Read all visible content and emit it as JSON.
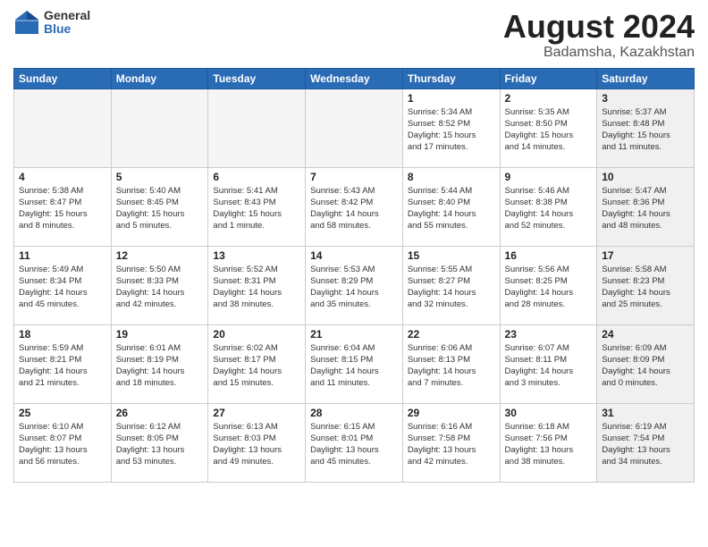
{
  "header": {
    "logo_general": "General",
    "logo_blue": "Blue",
    "title": "August 2024",
    "location": "Badamsha, Kazakhstan"
  },
  "weekdays": [
    "Sunday",
    "Monday",
    "Tuesday",
    "Wednesday",
    "Thursday",
    "Friday",
    "Saturday"
  ],
  "weeks": [
    [
      {
        "day": "",
        "detail": "",
        "empty": true
      },
      {
        "day": "",
        "detail": "",
        "empty": true
      },
      {
        "day": "",
        "detail": "",
        "empty": true
      },
      {
        "day": "",
        "detail": "",
        "empty": true
      },
      {
        "day": "1",
        "detail": "Sunrise: 5:34 AM\nSunset: 8:52 PM\nDaylight: 15 hours\nand 17 minutes."
      },
      {
        "day": "2",
        "detail": "Sunrise: 5:35 AM\nSunset: 8:50 PM\nDaylight: 15 hours\nand 14 minutes."
      },
      {
        "day": "3",
        "detail": "Sunrise: 5:37 AM\nSunset: 8:48 PM\nDaylight: 15 hours\nand 11 minutes.",
        "shaded": true
      }
    ],
    [
      {
        "day": "4",
        "detail": "Sunrise: 5:38 AM\nSunset: 8:47 PM\nDaylight: 15 hours\nand 8 minutes."
      },
      {
        "day": "5",
        "detail": "Sunrise: 5:40 AM\nSunset: 8:45 PM\nDaylight: 15 hours\nand 5 minutes."
      },
      {
        "day": "6",
        "detail": "Sunrise: 5:41 AM\nSunset: 8:43 PM\nDaylight: 15 hours\nand 1 minute."
      },
      {
        "day": "7",
        "detail": "Sunrise: 5:43 AM\nSunset: 8:42 PM\nDaylight: 14 hours\nand 58 minutes."
      },
      {
        "day": "8",
        "detail": "Sunrise: 5:44 AM\nSunset: 8:40 PM\nDaylight: 14 hours\nand 55 minutes."
      },
      {
        "day": "9",
        "detail": "Sunrise: 5:46 AM\nSunset: 8:38 PM\nDaylight: 14 hours\nand 52 minutes."
      },
      {
        "day": "10",
        "detail": "Sunrise: 5:47 AM\nSunset: 8:36 PM\nDaylight: 14 hours\nand 48 minutes.",
        "shaded": true
      }
    ],
    [
      {
        "day": "11",
        "detail": "Sunrise: 5:49 AM\nSunset: 8:34 PM\nDaylight: 14 hours\nand 45 minutes."
      },
      {
        "day": "12",
        "detail": "Sunrise: 5:50 AM\nSunset: 8:33 PM\nDaylight: 14 hours\nand 42 minutes."
      },
      {
        "day": "13",
        "detail": "Sunrise: 5:52 AM\nSunset: 8:31 PM\nDaylight: 14 hours\nand 38 minutes."
      },
      {
        "day": "14",
        "detail": "Sunrise: 5:53 AM\nSunset: 8:29 PM\nDaylight: 14 hours\nand 35 minutes."
      },
      {
        "day": "15",
        "detail": "Sunrise: 5:55 AM\nSunset: 8:27 PM\nDaylight: 14 hours\nand 32 minutes."
      },
      {
        "day": "16",
        "detail": "Sunrise: 5:56 AM\nSunset: 8:25 PM\nDaylight: 14 hours\nand 28 minutes."
      },
      {
        "day": "17",
        "detail": "Sunrise: 5:58 AM\nSunset: 8:23 PM\nDaylight: 14 hours\nand 25 minutes.",
        "shaded": true
      }
    ],
    [
      {
        "day": "18",
        "detail": "Sunrise: 5:59 AM\nSunset: 8:21 PM\nDaylight: 14 hours\nand 21 minutes."
      },
      {
        "day": "19",
        "detail": "Sunrise: 6:01 AM\nSunset: 8:19 PM\nDaylight: 14 hours\nand 18 minutes."
      },
      {
        "day": "20",
        "detail": "Sunrise: 6:02 AM\nSunset: 8:17 PM\nDaylight: 14 hours\nand 15 minutes."
      },
      {
        "day": "21",
        "detail": "Sunrise: 6:04 AM\nSunset: 8:15 PM\nDaylight: 14 hours\nand 11 minutes."
      },
      {
        "day": "22",
        "detail": "Sunrise: 6:06 AM\nSunset: 8:13 PM\nDaylight: 14 hours\nand 7 minutes."
      },
      {
        "day": "23",
        "detail": "Sunrise: 6:07 AM\nSunset: 8:11 PM\nDaylight: 14 hours\nand 3 minutes."
      },
      {
        "day": "24",
        "detail": "Sunrise: 6:09 AM\nSunset: 8:09 PM\nDaylight: 14 hours\nand 0 minutes.",
        "shaded": true
      }
    ],
    [
      {
        "day": "25",
        "detail": "Sunrise: 6:10 AM\nSunset: 8:07 PM\nDaylight: 13 hours\nand 56 minutes."
      },
      {
        "day": "26",
        "detail": "Sunrise: 6:12 AM\nSunset: 8:05 PM\nDaylight: 13 hours\nand 53 minutes."
      },
      {
        "day": "27",
        "detail": "Sunrise: 6:13 AM\nSunset: 8:03 PM\nDaylight: 13 hours\nand 49 minutes."
      },
      {
        "day": "28",
        "detail": "Sunrise: 6:15 AM\nSunset: 8:01 PM\nDaylight: 13 hours\nand 45 minutes."
      },
      {
        "day": "29",
        "detail": "Sunrise: 6:16 AM\nSunset: 7:58 PM\nDaylight: 13 hours\nand 42 minutes."
      },
      {
        "day": "30",
        "detail": "Sunrise: 6:18 AM\nSunset: 7:56 PM\nDaylight: 13 hours\nand 38 minutes."
      },
      {
        "day": "31",
        "detail": "Sunrise: 6:19 AM\nSunset: 7:54 PM\nDaylight: 13 hours\nand 34 minutes.",
        "shaded": true
      }
    ]
  ]
}
